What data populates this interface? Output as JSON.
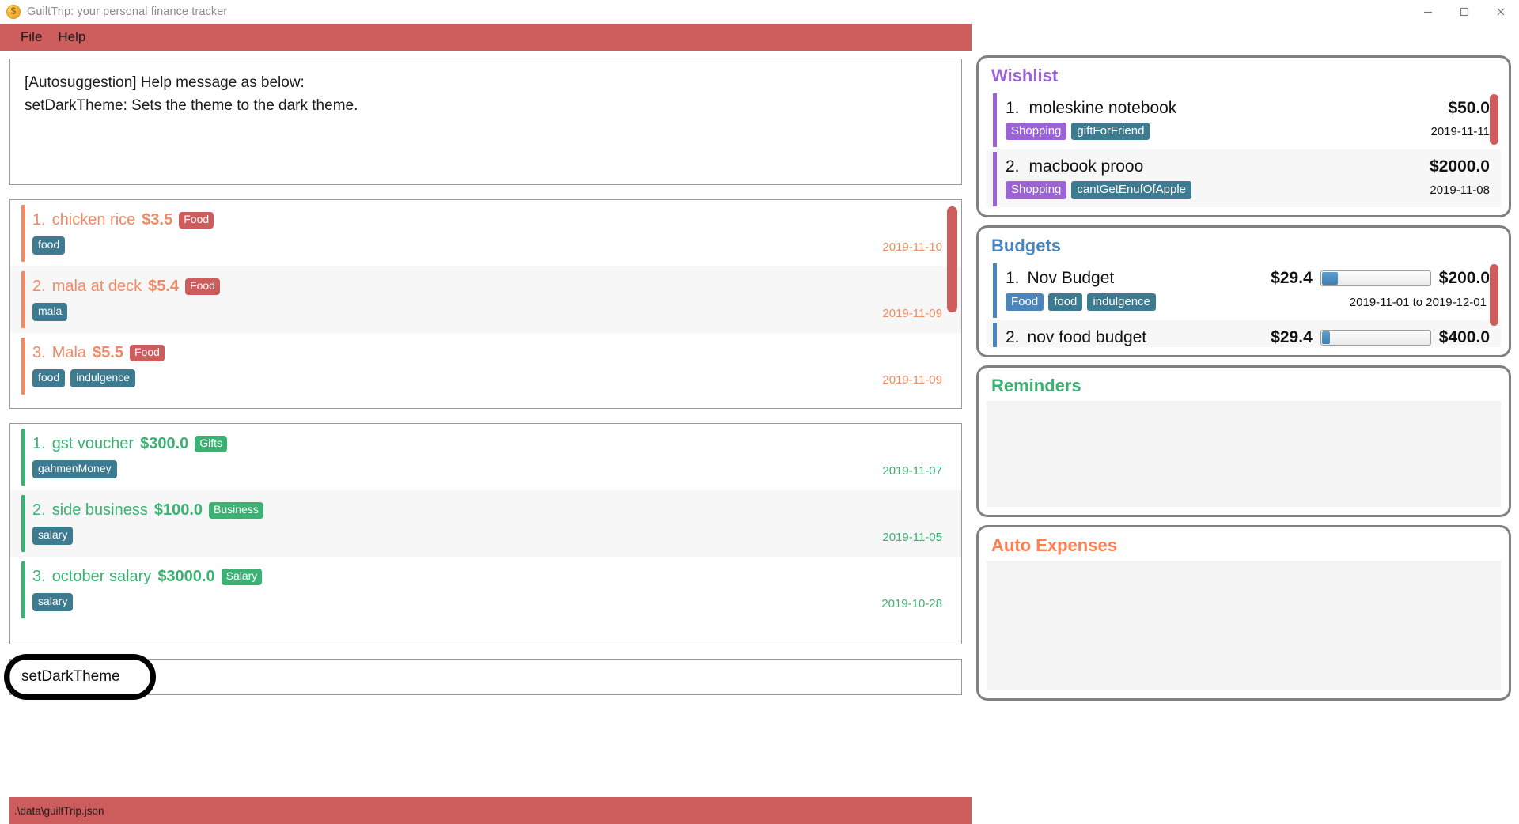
{
  "window": {
    "title": "GuiltTrip: your personal finance tracker",
    "app_icon": "coin-icon",
    "controls": {
      "minimize": "minimize-icon",
      "maximize": "maximize-icon",
      "close": "close-icon"
    }
  },
  "menubar": {
    "items": [
      {
        "label": "File"
      },
      {
        "label": "Help"
      }
    ]
  },
  "result_box": {
    "lines": [
      "[Autosuggestion] Help message as below:",
      "setDarkTheme: Sets the theme to the dark theme."
    ]
  },
  "expenses": {
    "accent_color": "#f08a64",
    "text_color": "#f08a64",
    "rows": [
      {
        "index": "1.",
        "name": "chicken rice",
        "amount": "$3.5",
        "category": "Food",
        "category_color": "#cd5c5c",
        "tags": [
          "food"
        ],
        "date": "2019-11-10"
      },
      {
        "index": "2.",
        "name": "mala at deck",
        "amount": "$5.4",
        "category": "Food",
        "category_color": "#cd5c5c",
        "tags": [
          "mala"
        ],
        "date": "2019-11-09"
      },
      {
        "index": "3.",
        "name": "Mala",
        "amount": "$5.5",
        "category": "Food",
        "category_color": "#cd5c5c",
        "tags": [
          "food",
          "indulgence"
        ],
        "date": "2019-11-09"
      }
    ]
  },
  "income": {
    "accent_color": "#3bb273",
    "text_color": "#3bb273",
    "rows": [
      {
        "index": "1.",
        "name": "gst voucher",
        "amount": "$300.0",
        "category": "Gifts",
        "category_color": "#3bb273",
        "tags": [
          "gahmenMoney"
        ],
        "date": "2019-11-07"
      },
      {
        "index": "2.",
        "name": "side business",
        "amount": "$100.0",
        "category": "Business",
        "category_color": "#3bb273",
        "tags": [
          "salary"
        ],
        "date": "2019-11-05"
      },
      {
        "index": "3.",
        "name": "october salary",
        "amount": "$3000.0",
        "category": "Salary",
        "category_color": "#3bb273",
        "tags": [
          "salary"
        ],
        "date": "2019-10-28"
      }
    ]
  },
  "command": {
    "value": "setDarkTheme",
    "placeholder": ""
  },
  "statusbar": {
    "path": ".\\data\\guiltTrip.json"
  },
  "wishlist": {
    "title": "Wishlist",
    "title_color": "#9b63d6",
    "accent_color": "#9b63d6",
    "items": [
      {
        "num": "1.",
        "name": "moleskine notebook",
        "amount": "$50.0",
        "category": "Shopping",
        "tags": [
          "giftForFriend"
        ],
        "date": "2019-11-11"
      },
      {
        "num": "2.",
        "name": "macbook prooo",
        "amount": "$2000.0",
        "category": "Shopping",
        "tags": [
          "cantGetEnufOfApple"
        ],
        "date": "2019-11-08"
      }
    ]
  },
  "budgets": {
    "title": "Budgets",
    "title_color": "#4a86bd",
    "accent_color": "#4a86bd",
    "items": [
      {
        "num": "1.",
        "name": "Nov Budget",
        "spent": "$29.4",
        "total": "$200.0",
        "percent": 14.7,
        "category": "Food",
        "tags": [
          "food",
          "indulgence"
        ],
        "range": "2019-11-01 to 2019-12-01"
      },
      {
        "num": "2.",
        "name": "nov food budget",
        "spent": "$29.4",
        "total": "$400.0",
        "percent": 7.35,
        "category": "",
        "tags": [],
        "range": ""
      }
    ]
  },
  "reminders": {
    "title": "Reminders",
    "title_color": "#3bb273",
    "items": []
  },
  "auto_expenses": {
    "title": "Auto Expenses",
    "title_color": "#ff7f50",
    "items": []
  }
}
